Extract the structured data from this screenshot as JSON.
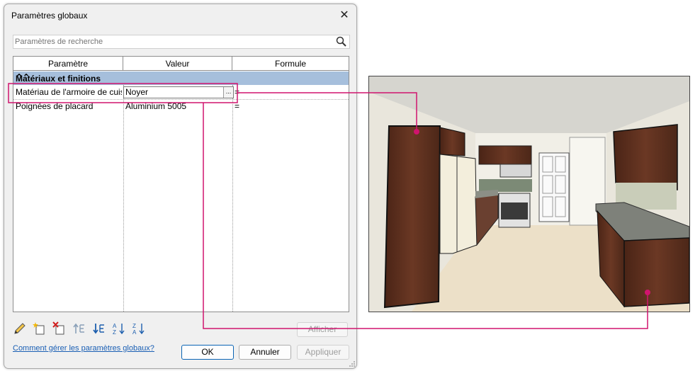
{
  "dialog": {
    "title": "Paramètres globaux",
    "close_symbol": "✕",
    "search_placeholder": "Paramètres de recherche",
    "columns": [
      "Paramètre",
      "Valeur",
      "Formule"
    ],
    "group": {
      "label": "Matériaux et finitions",
      "toggle_symbol": "⌃⌃"
    },
    "rows": [
      {
        "param": "Matériau de l'armoire de cuisine",
        "value": "Noyer",
        "formula": "="
      },
      {
        "param": "Poignées de placard",
        "value": "Aluminium 5005",
        "formula": "="
      }
    ],
    "browse_symbol": "...",
    "toolbar_icons": [
      "edit-pencil-icon",
      "new-parameter-icon",
      "delete-parameter-icon",
      "move-up-icon",
      "move-down-icon",
      "sort-ascending-icon",
      "sort-descending-icon"
    ],
    "show_label": "Afficher",
    "help_link": "Comment gérer les paramètres globaux?",
    "ok_label": "OK",
    "cancel_label": "Annuler",
    "apply_label": "Appliquer"
  },
  "colors": {
    "group_header": "#a6bfdc",
    "highlight": "#d0146e",
    "cabinet_wood": "#5a2e1e",
    "primary_border": "#0a64b4"
  }
}
